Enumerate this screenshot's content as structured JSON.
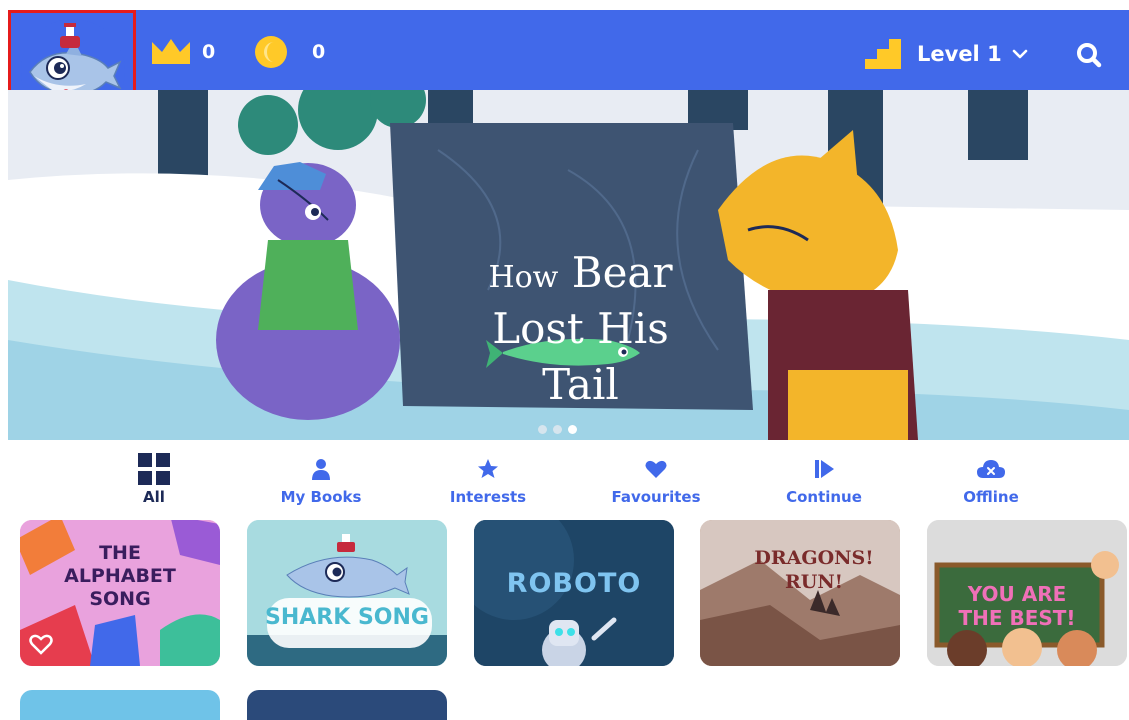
{
  "header": {
    "crowns": "0",
    "coins": "0",
    "level": "Level 1",
    "brand_color": "#4169ea",
    "icons": [
      "avatar-shark-icon",
      "crown-icon",
      "coin-icon",
      "level-steps-icon",
      "chevron-down-icon",
      "search-icon"
    ]
  },
  "hero": {
    "title_word1": "How",
    "title_word2": "Bear",
    "title_line2": "Lost His",
    "title_line3": "Tail",
    "slide_count": 3,
    "active_slide": 3
  },
  "tabs": [
    {
      "label": "All",
      "icon": "grid-icon",
      "active": true
    },
    {
      "label": "My Books",
      "icon": "person-icon",
      "active": false
    },
    {
      "label": "Interests",
      "icon": "star-icon",
      "active": false
    },
    {
      "label": "Favourites",
      "icon": "heart-icon",
      "active": false
    },
    {
      "label": "Continue",
      "icon": "play-icon",
      "active": false
    },
    {
      "label": "Offline",
      "icon": "cloud-icon",
      "active": false
    }
  ],
  "books": [
    {
      "line1": "THE",
      "line2": "ALPHABET",
      "line3": "SONG"
    },
    {
      "title": "SHARK SONG"
    },
    {
      "title": "ROBOTO"
    },
    {
      "line1": "DRAGONS!",
      "line2": "RUN!"
    },
    {
      "line1": "YOU ARE",
      "line2": "THE BEST!"
    }
  ]
}
